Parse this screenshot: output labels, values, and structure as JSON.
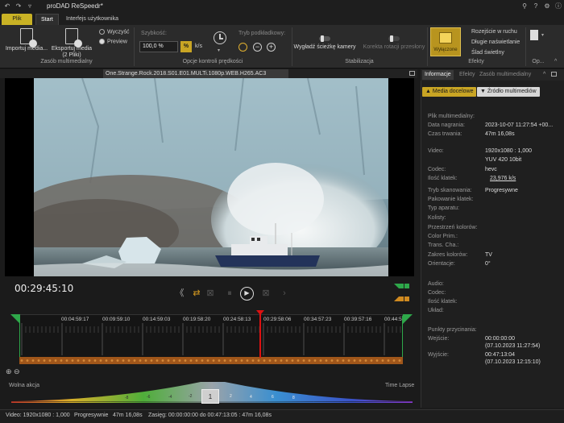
{
  "titlebar": {
    "title": "proDAD ReSpeedr*"
  },
  "tabs": {
    "plik": "Plik",
    "start": "Start",
    "interface": "Interfejs użytkownika"
  },
  "ribbon": {
    "import_label": "Importuj media...",
    "export_label": "Eksportuj media",
    "export_sub": "(2 Pliki)",
    "clear_label": "Wyczyść",
    "preview_label": "Preview",
    "media_group": "Zasób multimedialny",
    "speed_label": "Szybkość:",
    "speed_value": "100,0 %",
    "percent_btn": "%",
    "ks_label": "k/s",
    "subtitle_mode_label": "Tryb podkładkowy:",
    "speed_group": "Opcje kontroli prędkości",
    "smooth_label": "Wygładź ścieżkę kamery",
    "rotation_label": "Korekta rotacji przesłony",
    "stab_group": "Stabilizacja",
    "disabled_label": "Wyłączone",
    "effect_blur": "Rozejście w ruchu",
    "effect_long": "Długie naświetlanie",
    "effect_trail": "Ślad świetlny",
    "effects_group": "Efekty",
    "options_group": "Op..."
  },
  "video": {
    "filename": "One.Strange.Rock.2018.S01.E01.MULTi.1080p.WEB.H265.AC3"
  },
  "transport": {
    "timecode": "00:29:45:10"
  },
  "timeline": {
    "ticks": [
      "00:04:59:17",
      "00:09:59:10",
      "00:14:59:03",
      "00:19:58:20",
      "00:24:58:13",
      "00:29:58:06",
      "00:34:57:23",
      "00:39:57:16",
      "00:44:5"
    ]
  },
  "speed_curve": {
    "left_label": "Wolna akcja",
    "right_label": "Time Lapse",
    "center_value": "1",
    "marks": [
      "-8",
      "-6",
      "-4",
      "-2",
      "2",
      "4",
      "6",
      "8"
    ]
  },
  "status": {
    "video": "Video: 1920x1080 : 1,000",
    "scan": "Progresywnie",
    "duration": "47m 16,08s",
    "range": "Zasięg: 00:00:00:00 do 00:47:13:05 : 47m 16,08s"
  },
  "panel": {
    "tab_info": "Informacje",
    "tab_effects": "Efekty",
    "tab_media": "Zasób multimedialny",
    "btn_target": "Media docelowe",
    "btn_source": "Źródło multimediów",
    "rows": [
      {
        "label": "Plik multimedialny:",
        "value": ""
      },
      {
        "label": "Data nagrania:",
        "value": "2023-10-07 11:27:54 +00..."
      },
      {
        "label": "Czas trwania:",
        "value": "47m 16,08s"
      },
      {
        "label": "Video:",
        "value": "1920x1080 : 1,000"
      },
      {
        "label": "",
        "value": "YUV 420 10bit"
      },
      {
        "label": "Codec:",
        "value": "hevc"
      },
      {
        "label": "Ilość klatek:",
        "value": "23,976 k/s"
      },
      {
        "label": "Tryb skanowania:",
        "value": "Progresywne"
      },
      {
        "label": "Pakowanie klatek:",
        "value": ""
      },
      {
        "label": "Typ aparatu:",
        "value": ""
      },
      {
        "label": "Kolisty:",
        "value": ""
      },
      {
        "label": "Przestrzeń kolorów:",
        "value": ""
      },
      {
        "label": "Color Prim.:",
        "value": ""
      },
      {
        "label": "Trans. Cha.:",
        "value": ""
      },
      {
        "label": "Zakres kolorów:",
        "value": "TV"
      },
      {
        "label": "Orientacje:",
        "value": "0°"
      },
      {
        "label": "Audio:",
        "value": ""
      },
      {
        "label": "Codec:",
        "value": ""
      },
      {
        "label": "Ilość klatek:",
        "value": ""
      },
      {
        "label": "Układ:",
        "value": ""
      },
      {
        "label": "Punkty przycinania:",
        "value": ""
      },
      {
        "label": "Wejście:",
        "value": "00:00:00:00"
      },
      {
        "label": "",
        "value": "(07.10.2023 11:27:54)"
      },
      {
        "label": "Wyjście:",
        "value": "00:47:13:04"
      },
      {
        "label": "",
        "value": "(07.10.2023 12:15:10)"
      }
    ]
  },
  "colors": {
    "accent": "#c9a524",
    "playhead": "#dd1111",
    "timeline_bar": "#a0561a"
  }
}
